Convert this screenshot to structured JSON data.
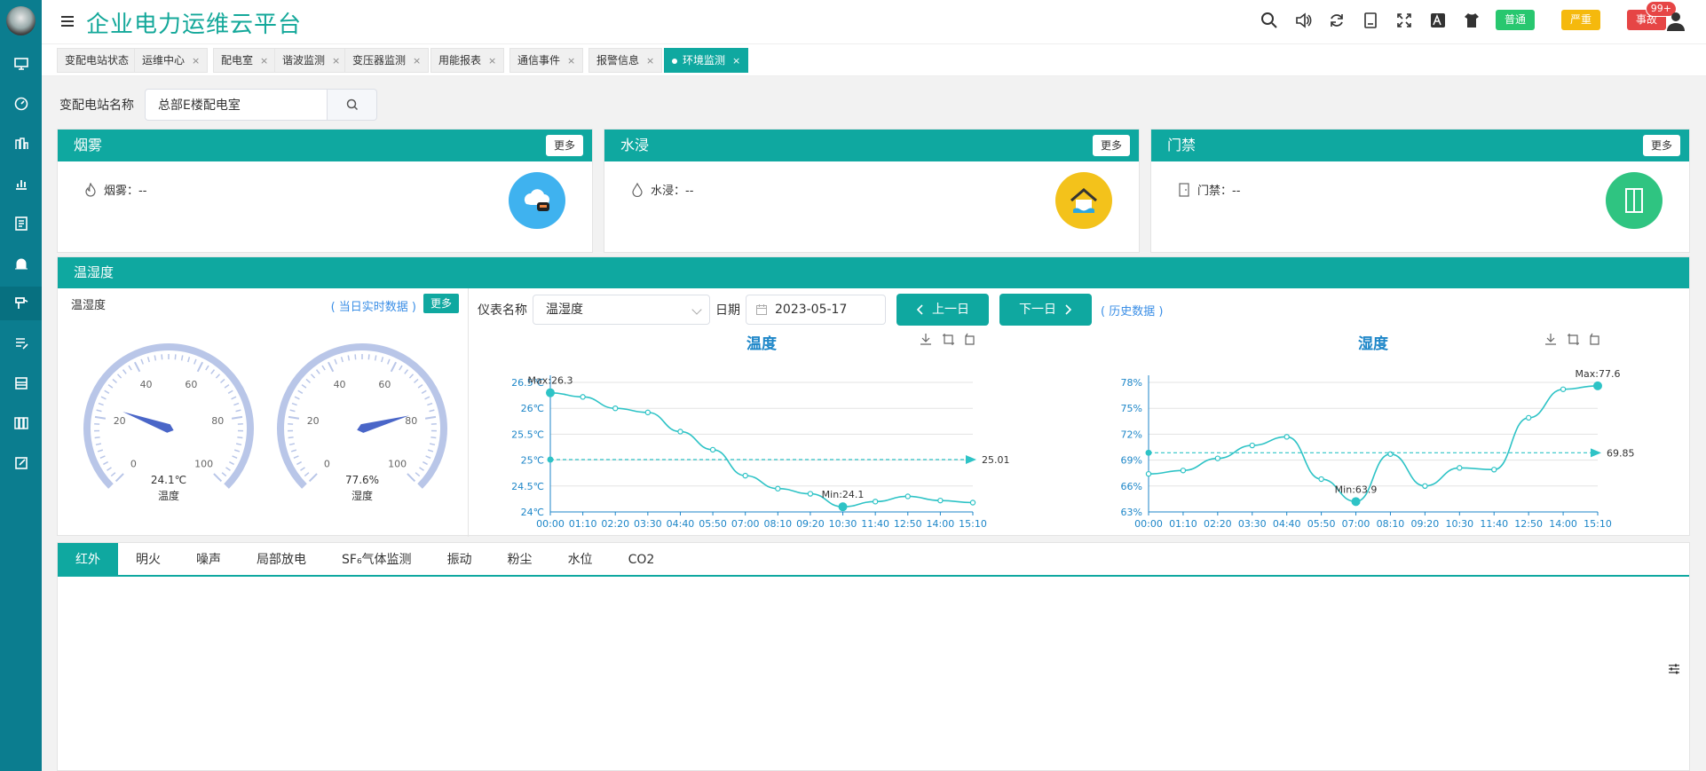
{
  "app": {
    "title": "企业电力运维云平台"
  },
  "header": {
    "badges": {
      "normal": "普通",
      "serious": "严重",
      "accident": "事故",
      "accident_count": "99+"
    },
    "icons": [
      "search-icon",
      "volume-icon",
      "refresh-icon",
      "book-icon",
      "fullscreen-icon",
      "font-size-icon",
      "theme-icon"
    ]
  },
  "tabs": [
    {
      "label": "变配电站状态",
      "closable": false
    },
    {
      "label": "运维中心",
      "closable": true
    },
    {
      "label": "配电室",
      "closable": true
    },
    {
      "label": "谐波监测",
      "closable": true
    },
    {
      "label": "变压器监测",
      "closable": true
    },
    {
      "label": "用能报表",
      "closable": true
    },
    {
      "label": "通信事件",
      "closable": true
    },
    {
      "label": "报警信息",
      "closable": true
    },
    {
      "label": "环境监测",
      "closable": true,
      "active": true
    }
  ],
  "search": {
    "label": "变配电站名称",
    "value": "总部E楼配电室"
  },
  "cards": {
    "smoke": {
      "title": "烟雾",
      "more": "更多",
      "stat": "烟雾：--"
    },
    "water": {
      "title": "水浸",
      "more": "更多",
      "stat": "水浸：--"
    },
    "door": {
      "title": "门禁",
      "more": "更多",
      "stat": "门禁：--"
    }
  },
  "th": {
    "title": "温湿度",
    "left_title": "温湿度",
    "realtime_link": "( 当日实时数据 )",
    "more": "更多",
    "gauges": [
      {
        "value": 24.1,
        "reading": "24.1℃",
        "label": "温度",
        "ticks": [
          "0",
          "20",
          "40",
          "60",
          "80",
          "100"
        ]
      },
      {
        "value": 77.6,
        "reading": "77.6%",
        "label": "湿度",
        "ticks": [
          "0",
          "20",
          "40",
          "60",
          "80",
          "100"
        ]
      }
    ],
    "filter": {
      "meter_label": "仪表名称",
      "meter_value": "温湿度",
      "date_label": "日期",
      "date_value": "2023-05-17",
      "prev_label": "上一日",
      "next_label": "下一日",
      "history_link": "( 历史数据 )"
    }
  },
  "chart_data": [
    {
      "type": "line",
      "title": "温度",
      "x": [
        "00:00",
        "01:10",
        "02:20",
        "03:30",
        "04:40",
        "05:50",
        "07:00",
        "08:10",
        "09:20",
        "10:30",
        "11:40",
        "12:50",
        "14:00",
        "15:10"
      ],
      "ytick_labels": [
        "24℃",
        "24.5℃",
        "25℃",
        "25.5℃",
        "26℃",
        "26.5℃"
      ],
      "ylim": [
        24,
        26.5
      ],
      "series": [
        {
          "values": [
            26.3,
            26.22,
            26.0,
            25.92,
            25.55,
            25.2,
            24.7,
            24.45,
            24.35,
            24.1,
            24.2,
            24.3,
            24.22,
            24.18
          ]
        }
      ],
      "max_label": "Max:26.3",
      "min_label": "Min:24.1",
      "avg": 25.01,
      "avg_label": "25.01"
    },
    {
      "type": "line",
      "title": "湿度",
      "x": [
        "00:00",
        "01:10",
        "02:20",
        "03:30",
        "04:40",
        "05:50",
        "07:00",
        "08:10",
        "09:20",
        "10:30",
        "11:40",
        "12:50",
        "14:00",
        "15:10"
      ],
      "ytick_labels": [
        "63%",
        "66%",
        "69%",
        "72%",
        "75%",
        "78%"
      ],
      "ylim": [
        63,
        78
      ],
      "series": [
        {
          "values": [
            67.4,
            67.8,
            69.2,
            70.7,
            71.7,
            66.8,
            64.2,
            69.7,
            66.0,
            68.1,
            67.9,
            73.9,
            77.2,
            77.6
          ]
        }
      ],
      "max_label": "Max:77.6",
      "min_label": "Min:63.9",
      "avg": 69.85,
      "avg_label": "69.85"
    }
  ],
  "bottom_tabs": [
    "红外",
    "明火",
    "噪声",
    "局部放电",
    "SF₆气体监测",
    "振动",
    "粉尘",
    "水位",
    "CO2"
  ]
}
